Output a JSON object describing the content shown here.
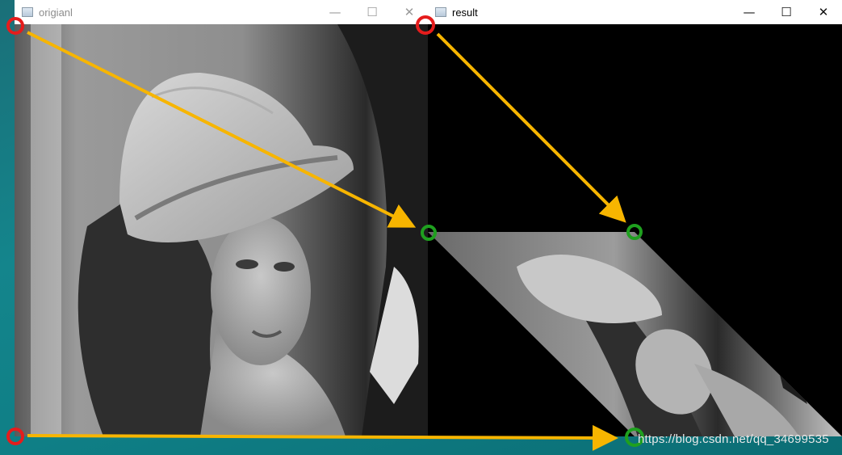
{
  "windows": {
    "left": {
      "title": "origianl",
      "minimize": "—",
      "maximize": "☐",
      "close": "✕"
    },
    "right": {
      "title": "result",
      "minimize": "—",
      "maximize": "☐",
      "close": "✕"
    }
  },
  "images": {
    "original_description": "grayscale portrait photo",
    "result_description": "same portrait after affine shear transform"
  },
  "annotations": {
    "source_marker_color": "#e51c1c",
    "target_marker_color": "#1fa01f",
    "arrow_color": "#f7b500"
  },
  "watermark": "https://blog.csdn.net/qq_34699535"
}
